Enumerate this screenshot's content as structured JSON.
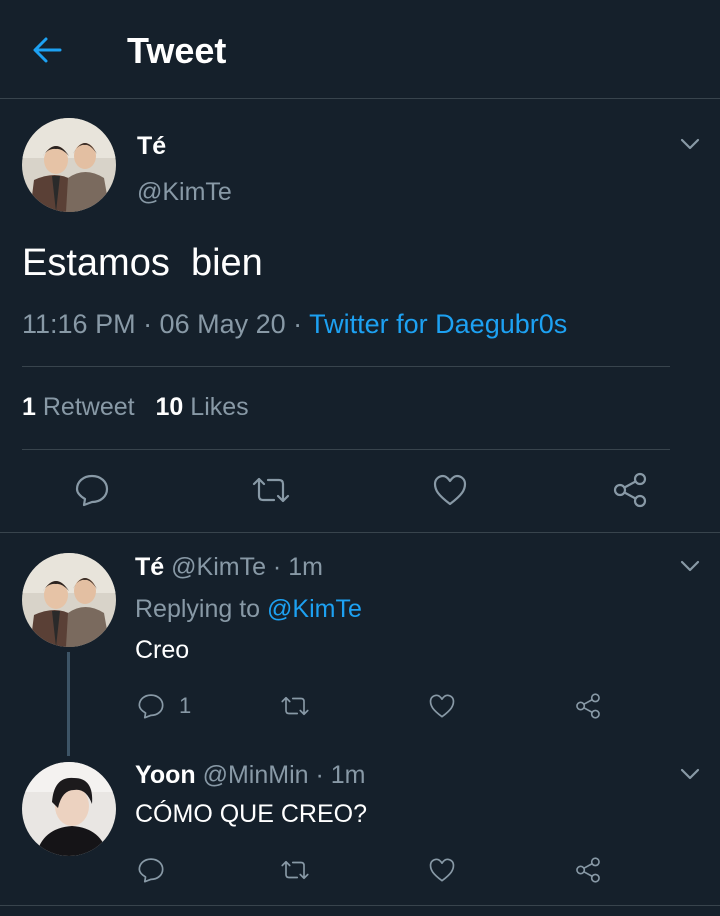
{
  "header": {
    "title": "Tweet"
  },
  "tweet": {
    "display_name": "Té",
    "handle": "@KimTe",
    "text": "Estamos  bien",
    "time": "11:16 PM · 06 May 20 ·",
    "source": "Twitter for Daegubr0s",
    "retweets_count": "1",
    "retweets_label": "Retweet",
    "likes_count": "10",
    "likes_label": "Likes"
  },
  "replies": [
    {
      "display_name": "Té",
      "meta": "@KimTe · 1m",
      "replying_prefix": "Replying to",
      "replying_handle": "@KimTe",
      "text": "Creo",
      "reply_count": "1"
    },
    {
      "display_name": "Yoon",
      "meta": "@MinMin · 1m",
      "text": "CÓMO QUE CREO?"
    }
  ],
  "icons": {
    "back": "arrow-left-icon",
    "caret": "chevron-down-icon",
    "reply": "speech-bubble-icon",
    "retweet": "retweet-icon",
    "like": "heart-icon",
    "share": "share-icon"
  },
  "colors": {
    "background": "#15202b",
    "accent": "#1da1f2",
    "muted": "#8899a6",
    "divider": "#38444d"
  }
}
